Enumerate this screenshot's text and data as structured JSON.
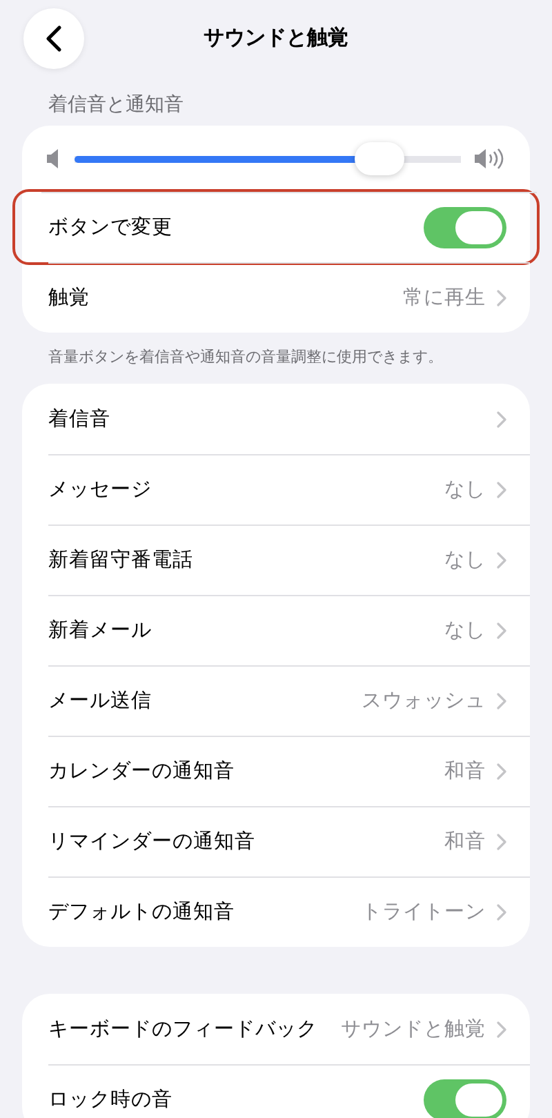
{
  "header": {
    "title": "サウンドと触覚"
  },
  "section": {
    "title": "着信音と通知音",
    "volume": {
      "level": 0.79
    },
    "rows": [
      {
        "kind": "toggle",
        "label": "ボタンで変更",
        "on": true,
        "highlighted": true
      },
      {
        "kind": "chevron",
        "label": "触覚",
        "value": "常に再生",
        "highlighted": false
      }
    ],
    "footnote": "音量ボタンを着信音や通知音の音量調整に使用できます。"
  },
  "sounds": [
    {
      "kind": "chevron",
      "label": "着信音"
    },
    {
      "kind": "chevron",
      "label": "メッセージ",
      "value": "なし"
    },
    {
      "kind": "chevron",
      "label": "新着留守番電話",
      "value": "なし"
    },
    {
      "kind": "chevron",
      "label": "新着メール",
      "value": "なし"
    },
    {
      "kind": "chevron",
      "label": "メール送信",
      "value": "スウォッシュ"
    },
    {
      "kind": "chevron",
      "label": "カレンダーの通知音",
      "value": "和音"
    },
    {
      "kind": "chevron",
      "label": "リマインダーの通知音",
      "value": "和音"
    },
    {
      "kind": "chevron",
      "label": "デフォルトの通知音",
      "value": "トライトーン"
    }
  ],
  "other": [
    {
      "kind": "chevron",
      "label": "キーボードのフィードバック",
      "value": "サウンドと触覚"
    },
    {
      "kind": "toggle",
      "label": "ロック時の音",
      "on": true
    }
  ]
}
